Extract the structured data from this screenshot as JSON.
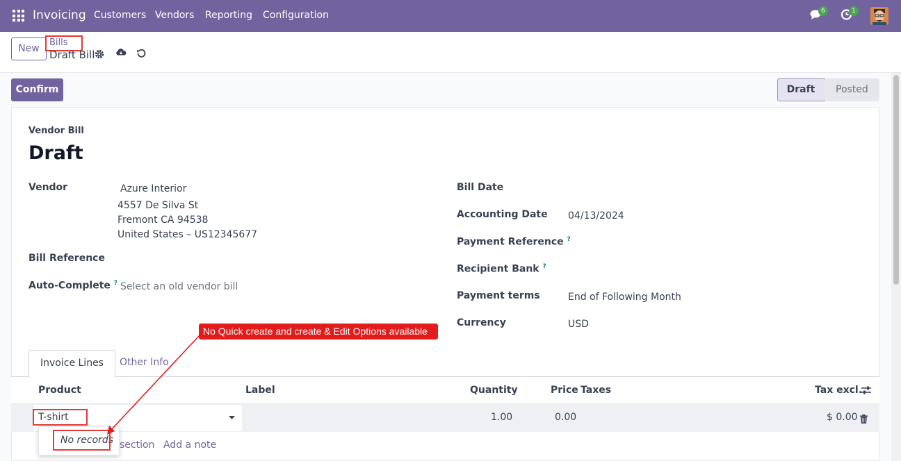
{
  "navbar": {
    "app_name": "Invoicing",
    "menu": [
      "Customers",
      "Vendors",
      "Reporting",
      "Configuration"
    ],
    "messages_count": "6",
    "activities_count": "1"
  },
  "control_panel": {
    "new_label": "New",
    "breadcrumb_parent": "Bills",
    "breadcrumb_current": "Draft Bill"
  },
  "statusbar": {
    "confirm_label": "Confirm",
    "stages": [
      "Draft",
      "Posted"
    ]
  },
  "form": {
    "subtitle": "Vendor Bill",
    "title": "Draft",
    "vendor_label": "Vendor",
    "vendor_name": "Azure Interior",
    "vendor_address": [
      "4557 De Silva St",
      "Fremont CA 94538",
      "United States – US12345677"
    ],
    "bill_reference_label": "Bill Reference",
    "auto_complete_label": "Auto-Complete",
    "auto_complete_placeholder": "Select an old vendor bill",
    "bill_date_label": "Bill Date",
    "accounting_date_label": "Accounting Date",
    "accounting_date": "04/13/2024",
    "payment_reference_label": "Payment Reference",
    "recipient_bank_label": "Recipient Bank",
    "payment_terms_label": "Payment terms",
    "payment_terms": "End of Following Month",
    "currency_label": "Currency",
    "currency": "USD",
    "help_mark": "?"
  },
  "tabs": [
    "Invoice Lines",
    "Other Info"
  ],
  "lines_table": {
    "headers": {
      "product": "Product",
      "label": "Label",
      "quantity": "Quantity",
      "price": "Price",
      "taxes": "Taxes",
      "tax_excl": "Tax excl."
    },
    "row": {
      "product": "T-shirt",
      "quantity": "1.00",
      "price": "0.00",
      "tax_excl": "$ 0.00"
    },
    "dropdown_empty": "No records",
    "add_section": "section",
    "add_note": "Add a note"
  },
  "annotation": {
    "text": "No Quick create and create & Edit Options available",
    "color": "#e21b1b"
  },
  "colors": {
    "brand": "#71639e",
    "badge": "#4aa350",
    "highlight": "#e53935"
  }
}
